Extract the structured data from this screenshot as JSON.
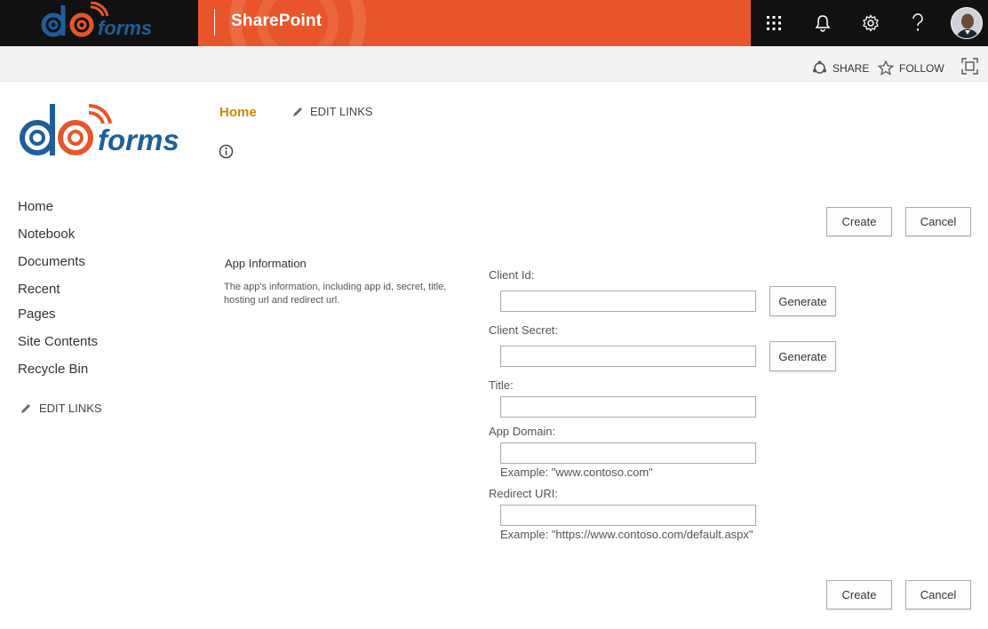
{
  "suitebar": {
    "brand_main": "do",
    "brand_suffix": "forms",
    "app_title": "SharePoint",
    "colors": {
      "accent": "#e8552a",
      "dark": "#111111"
    },
    "icons": [
      "app-launcher-icon",
      "bell-icon",
      "gear-icon",
      "help-icon"
    ]
  },
  "commandbar": {
    "share_label": "SHARE",
    "follow_label": "FOLLOW"
  },
  "site": {
    "logo_main": "do",
    "logo_suffix": "forms",
    "topnav_home": "Home",
    "topnav_edit": "EDIT LINKS"
  },
  "leftnav": {
    "items": [
      {
        "label": "Home"
      },
      {
        "label": "Notebook"
      },
      {
        "label": "Documents"
      },
      {
        "label": "Recent"
      },
      {
        "label": "Pages"
      },
      {
        "label": "Site Contents"
      },
      {
        "label": "Recycle Bin"
      }
    ],
    "edit_links": "EDIT LINKS"
  },
  "actions": {
    "create_label": "Create",
    "cancel_label": "Cancel"
  },
  "form": {
    "section_title": "App Information",
    "section_desc": "The app's information, including app id, secret, title, hosting url and redirect url.",
    "generate_label": "Generate",
    "fields": {
      "client_id": {
        "label": "Client Id:",
        "value": ""
      },
      "client_secret": {
        "label": "Client Secret:",
        "value": ""
      },
      "title": {
        "label": "Title:",
        "value": ""
      },
      "app_domain": {
        "label": "App Domain:",
        "value": "",
        "hint": "Example: \"www.contoso.com\""
      },
      "redirect_uri": {
        "label": "Redirect URI:",
        "value": "",
        "hint": "Example: \"https://www.contoso.com/default.aspx\""
      }
    }
  }
}
